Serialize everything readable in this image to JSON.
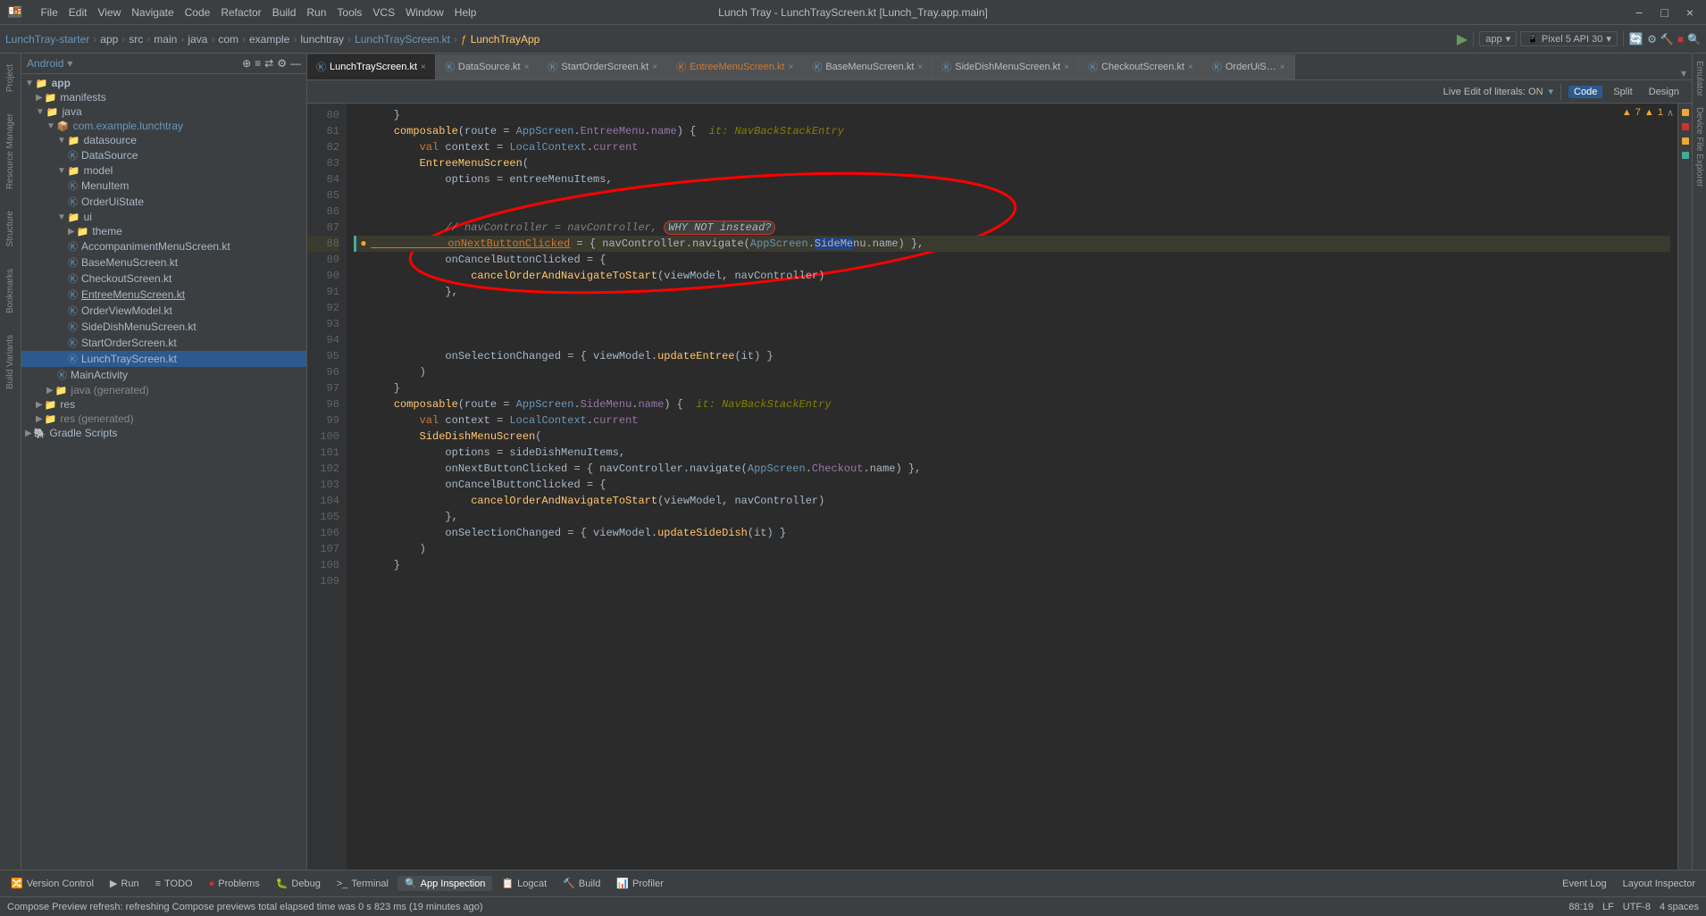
{
  "titleBar": {
    "title": "Lunch Tray - LunchTrayScreen.kt [Lunch_Tray.app.main]",
    "menuItems": [
      "File",
      "Edit",
      "View",
      "Navigate",
      "Code",
      "Refactor",
      "Build",
      "Run",
      "Tools",
      "VCS",
      "Window",
      "Help"
    ],
    "windowControls": [
      "−",
      "□",
      "×"
    ]
  },
  "breadcrumb": {
    "items": [
      "LunchTray-starter",
      "app",
      "src",
      "main",
      "java",
      "com",
      "example",
      "lunchtray"
    ],
    "file": "LunchTrayScreen.kt",
    "func": "LunchTrayApp"
  },
  "projectHeader": {
    "label": "Android",
    "buttons": [
      "⊕",
      "≡",
      "⇄",
      "⚙",
      "—"
    ]
  },
  "editorTabs": [
    {
      "name": "LunchTrayScreen.kt",
      "active": true,
      "color": "#6897bb"
    },
    {
      "name": "DataSource.kt",
      "active": false,
      "color": "#6897bb"
    },
    {
      "name": "StartOrderScreen.kt",
      "active": false,
      "color": "#6897bb"
    },
    {
      "name": "EntreeMenuScreen.kt",
      "active": false,
      "color": "#cc7832"
    },
    {
      "name": "BaseMenuScreen.kt",
      "active": false,
      "color": "#6897bb"
    },
    {
      "name": "SideDishMenuScreen.kt",
      "active": false,
      "color": "#6897bb"
    },
    {
      "name": "CheckoutScreen.kt",
      "active": false,
      "color": "#6897bb"
    },
    {
      "name": "OrderUiS…",
      "active": false,
      "color": "#6897bb"
    }
  ],
  "editorToolbar": {
    "liveEdit": "Live Edit of literals: ON",
    "modes": [
      "Code",
      "Split",
      "Design"
    ]
  },
  "codeLines": [
    {
      "num": 80,
      "text": "    }",
      "highlighted": false
    },
    {
      "num": 81,
      "text": "    composable(route = AppScreen.EntreeMenu.name) {",
      "highlighted": false,
      "annotation": "it: NavBackStackEntry"
    },
    {
      "num": 82,
      "text": "        val context = LocalContext.current",
      "highlighted": false
    },
    {
      "num": 83,
      "text": "        EntreeMenuScreen(",
      "highlighted": false
    },
    {
      "num": 84,
      "text": "            options = entreeMenuItems,",
      "highlighted": false
    },
    {
      "num": 85,
      "text": "",
      "highlighted": false
    },
    {
      "num": 86,
      "text": "",
      "highlighted": false
    },
    {
      "num": 87,
      "text": "            // navController = navController, WHY NOT instead?",
      "highlighted": false,
      "isComment": true
    },
    {
      "num": 88,
      "text": "            onNextButtonClicked = { navController.navigate(AppScreen.SideMenu.name) },",
      "highlighted": true,
      "hasIndicator": true,
      "hasBullet": true
    },
    {
      "num": 89,
      "text": "            onCancelButtonClicked = {",
      "highlighted": false
    },
    {
      "num": 90,
      "text": "                cancelOrderAndNavigateToStart(viewModel, navController)",
      "highlighted": false
    },
    {
      "num": 91,
      "text": "            },",
      "highlighted": false
    },
    {
      "num": 92,
      "text": "",
      "highlighted": false
    },
    {
      "num": 93,
      "text": "",
      "highlighted": false
    },
    {
      "num": 94,
      "text": "",
      "highlighted": false
    },
    {
      "num": 95,
      "text": "            onSelectionChanged = { viewModel.updateEntree(it) }",
      "highlighted": false
    },
    {
      "num": 96,
      "text": "        )",
      "highlighted": false
    },
    {
      "num": 97,
      "text": "    }",
      "highlighted": false
    },
    {
      "num": 98,
      "text": "    composable(route = AppScreen.SideMenu.name) {",
      "highlighted": false,
      "annotation": "it: NavBackStackEntry"
    },
    {
      "num": 99,
      "text": "        val context = LocalContext.current",
      "highlighted": false
    },
    {
      "num": 100,
      "text": "        SideDishMenuScreen(",
      "highlighted": false
    },
    {
      "num": 101,
      "text": "            options = sideDishMenuItems,",
      "highlighted": false
    },
    {
      "num": 102,
      "text": "            onNextButtonClicked = { navController.navigate(AppScreen.Checkout.name) },",
      "highlighted": false
    },
    {
      "num": 103,
      "text": "            onCancelButtonClicked = {",
      "highlighted": false
    },
    {
      "num": 104,
      "text": "                cancelOrderAndNavigateToStart(viewModel, navController)",
      "highlighted": false
    },
    {
      "num": 105,
      "text": "            },",
      "highlighted": false
    },
    {
      "num": 106,
      "text": "            onSelectionChanged = { viewModel.updateSideDish(it) }",
      "highlighted": false
    },
    {
      "num": 107,
      "text": "        )",
      "highlighted": false
    },
    {
      "num": 108,
      "text": "    }",
      "highlighted": false
    },
    {
      "num": 109,
      "text": "",
      "highlighted": false
    }
  ],
  "projectTree": {
    "items": [
      {
        "label": "app",
        "indent": 0,
        "type": "folder",
        "bold": true,
        "expanded": true
      },
      {
        "label": "manifests",
        "indent": 1,
        "type": "folder",
        "expanded": true
      },
      {
        "label": "java",
        "indent": 1,
        "type": "folder",
        "expanded": true
      },
      {
        "label": "com.example.lunchtray",
        "indent": 2,
        "type": "package",
        "expanded": true
      },
      {
        "label": "datasource",
        "indent": 3,
        "type": "folder",
        "expanded": true
      },
      {
        "label": "DataSource",
        "indent": 4,
        "type": "kotlin"
      },
      {
        "label": "model",
        "indent": 3,
        "type": "folder",
        "expanded": true
      },
      {
        "label": "MenuItem",
        "indent": 4,
        "type": "kotlin"
      },
      {
        "label": "OrderUiState",
        "indent": 4,
        "type": "kotlin"
      },
      {
        "label": "ui",
        "indent": 3,
        "type": "folder",
        "expanded": true
      },
      {
        "label": "theme",
        "indent": 4,
        "type": "folder",
        "expanded": false
      },
      {
        "label": "AccompanimentMenuScreen.kt",
        "indent": 4,
        "type": "kotlin"
      },
      {
        "label": "BaseMenuScreen.kt",
        "indent": 4,
        "type": "kotlin"
      },
      {
        "label": "CheckoutScreen.kt",
        "indent": 4,
        "type": "kotlin"
      },
      {
        "label": "EntreeMenuScreen.kt",
        "indent": 4,
        "type": "kotlin",
        "underline": true
      },
      {
        "label": "OrderViewModel.kt",
        "indent": 4,
        "type": "kotlin"
      },
      {
        "label": "SideDishMenuScreen.kt",
        "indent": 4,
        "type": "kotlin"
      },
      {
        "label": "StartOrderScreen.kt",
        "indent": 4,
        "type": "kotlin"
      },
      {
        "label": "LunchTrayScreen.kt",
        "indent": 4,
        "type": "kotlin",
        "selected": true
      },
      {
        "label": "MainActivity",
        "indent": 3,
        "type": "kotlin"
      },
      {
        "label": "java (generated)",
        "indent": 2,
        "type": "folder",
        "expanded": false
      },
      {
        "label": "res",
        "indent": 1,
        "type": "folder",
        "expanded": false
      },
      {
        "label": "res (generated)",
        "indent": 1,
        "type": "folder",
        "expanded": false
      },
      {
        "label": "Gradle Scripts",
        "indent": 0,
        "type": "gradle",
        "expanded": false
      }
    ]
  },
  "bottomTabs": [
    {
      "label": "Version Control",
      "icon": "🔀"
    },
    {
      "label": "Run",
      "icon": "▶"
    },
    {
      "label": "TODO",
      "icon": "≡"
    },
    {
      "label": "Problems",
      "icon": "⚠",
      "badge": "●"
    },
    {
      "label": "Debug",
      "icon": "🐛"
    },
    {
      "label": "Terminal",
      "icon": ">"
    },
    {
      "label": "App Inspection",
      "icon": "🔍",
      "active": true
    },
    {
      "label": "Logcat",
      "icon": "📋"
    },
    {
      "label": "Build",
      "icon": "🔨"
    },
    {
      "label": "Profiler",
      "icon": "📊"
    }
  ],
  "statusBar": {
    "message": "Compose Preview refresh: refreshing Compose previews total elapsed time was 0 s 823 ms (19 minutes ago)",
    "line": "88:19",
    "encoding": "UTF-8",
    "lineEnding": "LF",
    "indent": "4 spaces"
  },
  "rightPanel": {
    "warnings": "▲ 7  ▲ 1"
  },
  "leftSideTabs": [
    "Project",
    "Resource Manager",
    "Structure",
    "Bookmarks",
    "Build Variants"
  ],
  "rightSideTabs": [
    "Emulator",
    "Device File Explorer"
  ]
}
